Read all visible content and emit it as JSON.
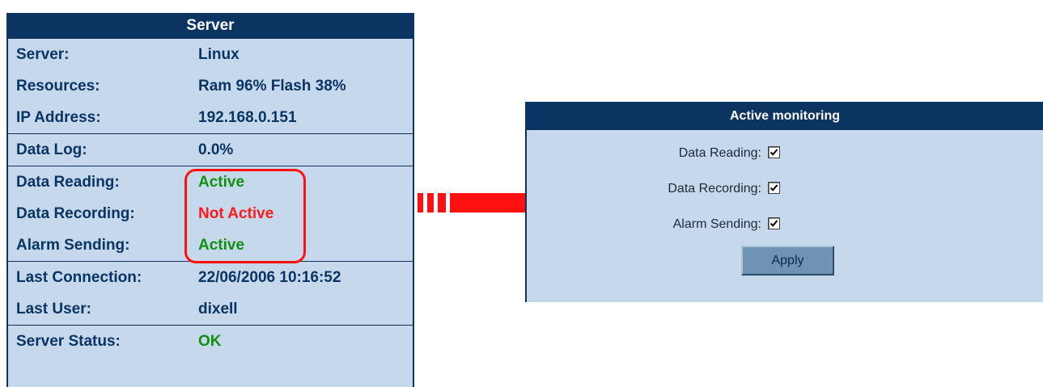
{
  "server_panel": {
    "title": "Server",
    "groups": [
      [
        {
          "label": "Server:",
          "value": "Linux"
        },
        {
          "label": "Resources:",
          "value": "Ram 96% Flash 38%"
        },
        {
          "label": "IP Address:",
          "value": "192.168.0.151"
        }
      ],
      [
        {
          "label": "Data Log:",
          "value": "0.0%"
        }
      ],
      [
        {
          "label": "Data Reading:",
          "value": "Active",
          "status_color": "#109010"
        },
        {
          "label": "Data Recording:",
          "value": "Not Active",
          "status_color": "#ff1a1a"
        },
        {
          "label": "Alarm Sending:",
          "value": "Active",
          "status_color": "#109010"
        }
      ],
      [
        {
          "label": "Last Connection:",
          "value": "22/06/2006 10:16:52"
        },
        {
          "label": "Last User:",
          "value": "dixell"
        }
      ],
      [
        {
          "label": "Server Status:",
          "value": "OK",
          "status_color": "#109010"
        }
      ]
    ]
  },
  "active_monitoring": {
    "title": "Active monitoring",
    "options": [
      {
        "label": "Data Reading:",
        "checked": true
      },
      {
        "label": "Data Recording:",
        "checked": true
      },
      {
        "label": "Alarm Sending:",
        "checked": true
      }
    ],
    "apply_label": "Apply"
  },
  "colors": {
    "header_bg": "#0b3463",
    "panel_bg": "#c6d9ec",
    "text": "#0b3463",
    "active": "#109010",
    "not_active": "#ff1a1a",
    "highlight": "#ff1010",
    "arrow": "#ff1010"
  },
  "icons": {
    "arrow": "right-arrow-icon",
    "checkbox": "checkbox-checked-icon"
  }
}
